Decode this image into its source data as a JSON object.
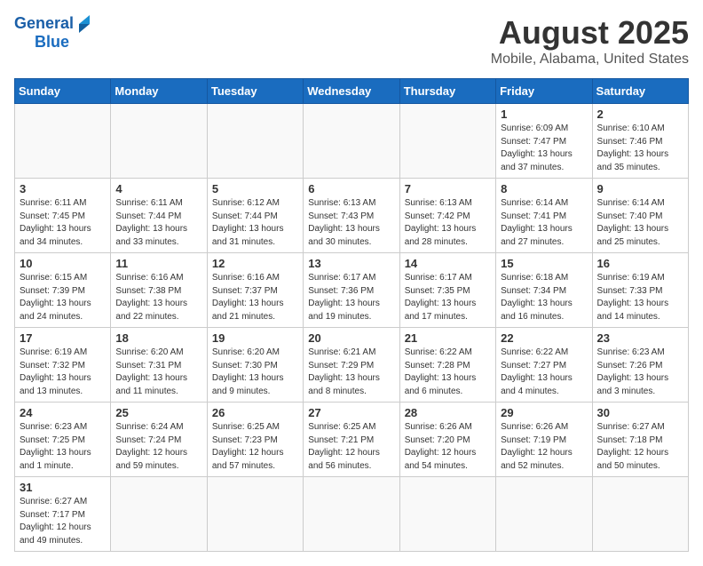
{
  "header": {
    "logo_general": "General",
    "logo_blue": "Blue",
    "month_title": "August 2025",
    "location": "Mobile, Alabama, United States"
  },
  "weekdays": [
    "Sunday",
    "Monday",
    "Tuesday",
    "Wednesday",
    "Thursday",
    "Friday",
    "Saturday"
  ],
  "weeks": [
    [
      {
        "day": "",
        "info": ""
      },
      {
        "day": "",
        "info": ""
      },
      {
        "day": "",
        "info": ""
      },
      {
        "day": "",
        "info": ""
      },
      {
        "day": "",
        "info": ""
      },
      {
        "day": "1",
        "info": "Sunrise: 6:09 AM\nSunset: 7:47 PM\nDaylight: 13 hours and 37 minutes."
      },
      {
        "day": "2",
        "info": "Sunrise: 6:10 AM\nSunset: 7:46 PM\nDaylight: 13 hours and 35 minutes."
      }
    ],
    [
      {
        "day": "3",
        "info": "Sunrise: 6:11 AM\nSunset: 7:45 PM\nDaylight: 13 hours and 34 minutes."
      },
      {
        "day": "4",
        "info": "Sunrise: 6:11 AM\nSunset: 7:44 PM\nDaylight: 13 hours and 33 minutes."
      },
      {
        "day": "5",
        "info": "Sunrise: 6:12 AM\nSunset: 7:44 PM\nDaylight: 13 hours and 31 minutes."
      },
      {
        "day": "6",
        "info": "Sunrise: 6:13 AM\nSunset: 7:43 PM\nDaylight: 13 hours and 30 minutes."
      },
      {
        "day": "7",
        "info": "Sunrise: 6:13 AM\nSunset: 7:42 PM\nDaylight: 13 hours and 28 minutes."
      },
      {
        "day": "8",
        "info": "Sunrise: 6:14 AM\nSunset: 7:41 PM\nDaylight: 13 hours and 27 minutes."
      },
      {
        "day": "9",
        "info": "Sunrise: 6:14 AM\nSunset: 7:40 PM\nDaylight: 13 hours and 25 minutes."
      }
    ],
    [
      {
        "day": "10",
        "info": "Sunrise: 6:15 AM\nSunset: 7:39 PM\nDaylight: 13 hours and 24 minutes."
      },
      {
        "day": "11",
        "info": "Sunrise: 6:16 AM\nSunset: 7:38 PM\nDaylight: 13 hours and 22 minutes."
      },
      {
        "day": "12",
        "info": "Sunrise: 6:16 AM\nSunset: 7:37 PM\nDaylight: 13 hours and 21 minutes."
      },
      {
        "day": "13",
        "info": "Sunrise: 6:17 AM\nSunset: 7:36 PM\nDaylight: 13 hours and 19 minutes."
      },
      {
        "day": "14",
        "info": "Sunrise: 6:17 AM\nSunset: 7:35 PM\nDaylight: 13 hours and 17 minutes."
      },
      {
        "day": "15",
        "info": "Sunrise: 6:18 AM\nSunset: 7:34 PM\nDaylight: 13 hours and 16 minutes."
      },
      {
        "day": "16",
        "info": "Sunrise: 6:19 AM\nSunset: 7:33 PM\nDaylight: 13 hours and 14 minutes."
      }
    ],
    [
      {
        "day": "17",
        "info": "Sunrise: 6:19 AM\nSunset: 7:32 PM\nDaylight: 13 hours and 13 minutes."
      },
      {
        "day": "18",
        "info": "Sunrise: 6:20 AM\nSunset: 7:31 PM\nDaylight: 13 hours and 11 minutes."
      },
      {
        "day": "19",
        "info": "Sunrise: 6:20 AM\nSunset: 7:30 PM\nDaylight: 13 hours and 9 minutes."
      },
      {
        "day": "20",
        "info": "Sunrise: 6:21 AM\nSunset: 7:29 PM\nDaylight: 13 hours and 8 minutes."
      },
      {
        "day": "21",
        "info": "Sunrise: 6:22 AM\nSunset: 7:28 PM\nDaylight: 13 hours and 6 minutes."
      },
      {
        "day": "22",
        "info": "Sunrise: 6:22 AM\nSunset: 7:27 PM\nDaylight: 13 hours and 4 minutes."
      },
      {
        "day": "23",
        "info": "Sunrise: 6:23 AM\nSunset: 7:26 PM\nDaylight: 13 hours and 3 minutes."
      }
    ],
    [
      {
        "day": "24",
        "info": "Sunrise: 6:23 AM\nSunset: 7:25 PM\nDaylight: 13 hours and 1 minute."
      },
      {
        "day": "25",
        "info": "Sunrise: 6:24 AM\nSunset: 7:24 PM\nDaylight: 12 hours and 59 minutes."
      },
      {
        "day": "26",
        "info": "Sunrise: 6:25 AM\nSunset: 7:23 PM\nDaylight: 12 hours and 57 minutes."
      },
      {
        "day": "27",
        "info": "Sunrise: 6:25 AM\nSunset: 7:21 PM\nDaylight: 12 hours and 56 minutes."
      },
      {
        "day": "28",
        "info": "Sunrise: 6:26 AM\nSunset: 7:20 PM\nDaylight: 12 hours and 54 minutes."
      },
      {
        "day": "29",
        "info": "Sunrise: 6:26 AM\nSunset: 7:19 PM\nDaylight: 12 hours and 52 minutes."
      },
      {
        "day": "30",
        "info": "Sunrise: 6:27 AM\nSunset: 7:18 PM\nDaylight: 12 hours and 50 minutes."
      }
    ],
    [
      {
        "day": "31",
        "info": "Sunrise: 6:27 AM\nSunset: 7:17 PM\nDaylight: 12 hours and 49 minutes."
      },
      {
        "day": "",
        "info": ""
      },
      {
        "day": "",
        "info": ""
      },
      {
        "day": "",
        "info": ""
      },
      {
        "day": "",
        "info": ""
      },
      {
        "day": "",
        "info": ""
      },
      {
        "day": "",
        "info": ""
      }
    ]
  ]
}
